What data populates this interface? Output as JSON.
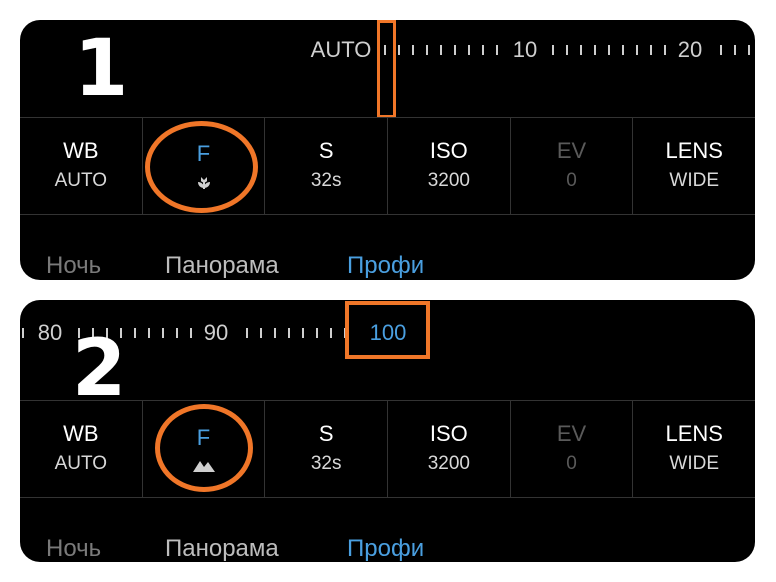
{
  "panels": [
    {
      "step": "1",
      "ruler_labels": [
        "AUTO",
        "10",
        "20"
      ],
      "controls": [
        {
          "title": "WB",
          "value": "AUTO"
        },
        {
          "title": "F",
          "value": "",
          "icon": "macro-flower-icon"
        },
        {
          "title": "S",
          "value": "32s"
        },
        {
          "title": "ISO",
          "value": "3200"
        },
        {
          "title": "EV",
          "value": "0"
        },
        {
          "title": "LENS",
          "value": "WIDE"
        }
      ],
      "modes": [
        "Ночь",
        "Панорама",
        "Профи"
      ]
    },
    {
      "step": "2",
      "ruler_labels": [
        "80",
        "90",
        "100"
      ],
      "selected_ruler_label": "100",
      "controls": [
        {
          "title": "WB",
          "value": "AUTO"
        },
        {
          "title": "F",
          "value": "",
          "icon": "mountain-landscape-icon"
        },
        {
          "title": "S",
          "value": "32s"
        },
        {
          "title": "ISO",
          "value": "3200"
        },
        {
          "title": "EV",
          "value": "0"
        },
        {
          "title": "LENS",
          "value": "WIDE"
        }
      ],
      "modes": [
        "Ночь",
        "Панорама",
        "Профи"
      ]
    }
  ],
  "colors": {
    "panel_bg": "#000000",
    "accent_blue": "#4a9fe0",
    "highlight_orange": "#f07628",
    "disabled_gray": "#5a5a5a"
  }
}
